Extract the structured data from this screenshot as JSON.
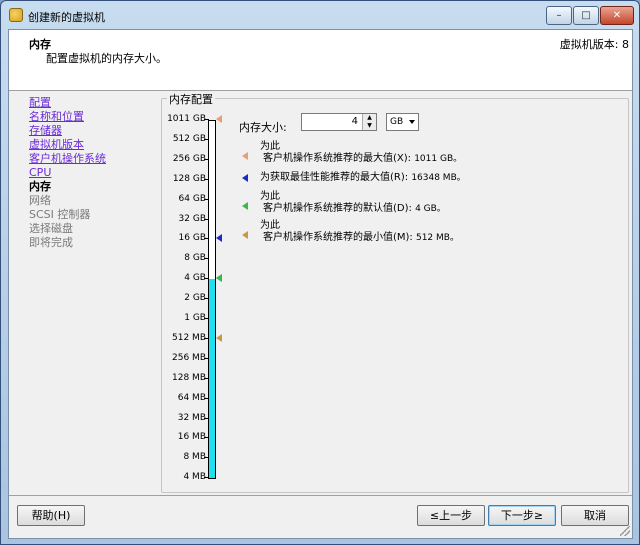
{
  "window": {
    "title": "创建新的虚拟机",
    "controls": {
      "minimize": "–",
      "maximize": "□",
      "close": "✕"
    }
  },
  "header": {
    "title": "内存",
    "description": "配置虚拟机的内存大小。",
    "version": "虚拟机版本: 8"
  },
  "nav": {
    "items": [
      {
        "label": "配置",
        "state": "link"
      },
      {
        "label": "名称和位置",
        "state": "link"
      },
      {
        "label": "存储器",
        "state": "link"
      },
      {
        "label": "虚拟机版本",
        "state": "link"
      },
      {
        "label": "客户机操作系统",
        "state": "link"
      },
      {
        "label": "CPU",
        "state": "link"
      },
      {
        "label": "内存",
        "state": "current"
      },
      {
        "label": "网络",
        "state": "disabled"
      },
      {
        "label": "SCSI 控制器",
        "state": "disabled"
      },
      {
        "label": "选择磁盘",
        "state": "disabled"
      },
      {
        "label": "即将完成",
        "state": "disabled"
      }
    ]
  },
  "memory": {
    "group_title": "内存配置",
    "size_label": "内存大小:",
    "size_value": "4",
    "unit": "GB",
    "scale_labels": [
      "1011 GB",
      "512 GB",
      "256 GB",
      "128 GB",
      "64 GB",
      "32 GB",
      "16 GB",
      "8 GB",
      "4 GB",
      "2 GB",
      "1 GB",
      "512 MB",
      "256 MB",
      "128 MB",
      "64 MB",
      "32 MB",
      "16 MB",
      "8 MB",
      "4 MB"
    ],
    "current_index": 8,
    "markers": [
      {
        "index": 0,
        "color": "#e8a070",
        "side": "left"
      },
      {
        "index": 6,
        "color": "#1a2cc8",
        "side": "left"
      },
      {
        "index": 8,
        "color": "#3ab84a",
        "side": "left"
      },
      {
        "index": 11,
        "color": "#c89a40",
        "side": "left"
      }
    ],
    "legend": [
      {
        "line1": "为此",
        "line2": "客户机操作系统推荐的最大值(X):",
        "value": "1011 GB。",
        "color": "#e8a070"
      },
      {
        "line1": "",
        "line2": "为获取最佳性能推荐的最大值(R):",
        "value": "16348 MB。",
        "color": "#1a2cc8"
      },
      {
        "line1": "为此",
        "line2": "客户机操作系统推荐的默认值(D):",
        "value": "4 GB。",
        "color": "#3ab84a"
      },
      {
        "line1": "为此",
        "line2": "客户机操作系统推荐的最小值(M):",
        "value": "512 MB。",
        "color": "#c89a40"
      }
    ]
  },
  "buttons": {
    "help": "帮助(H)",
    "back": "≤上一步",
    "next": "下一步≥",
    "cancel": "取消"
  }
}
